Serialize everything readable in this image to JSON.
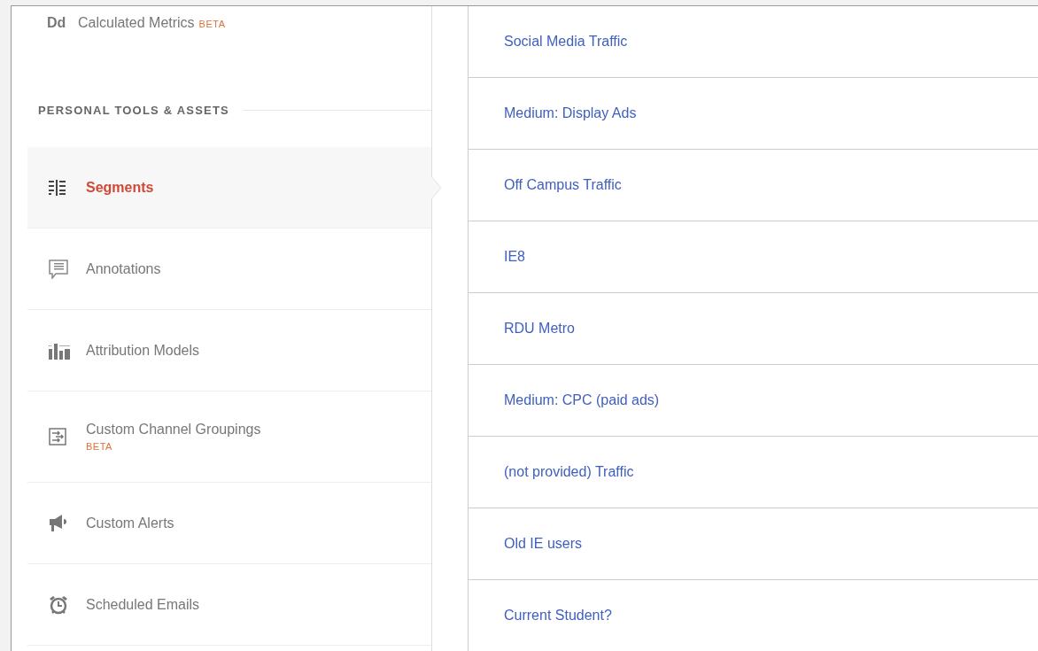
{
  "sidebar": {
    "top_item": {
      "icon_text": "Dd",
      "label": "Calculated Metrics",
      "beta": "BETA"
    },
    "section_header": "PERSONAL TOOLS & ASSETS",
    "items": [
      {
        "kind": "segments",
        "label": "Segments",
        "selected": true
      },
      {
        "kind": "annotations",
        "label": "Annotations",
        "selected": false
      },
      {
        "kind": "attribution",
        "label": "Attribution Models",
        "selected": false
      },
      {
        "kind": "channels",
        "label": "Custom Channel Groupings",
        "beta": "BETA",
        "selected": false
      },
      {
        "kind": "alerts",
        "label": "Custom Alerts",
        "selected": false
      },
      {
        "kind": "emails",
        "label": "Scheduled Emails",
        "selected": false
      }
    ]
  },
  "segments": [
    "Social Media Traffic",
    "Medium: Display Ads",
    "Off Campus Traffic",
    "IE8",
    "RDU Metro",
    "Medium: CPC (paid ads)",
    "(not provided) Traffic",
    "Old IE users",
    "Current Student?"
  ]
}
